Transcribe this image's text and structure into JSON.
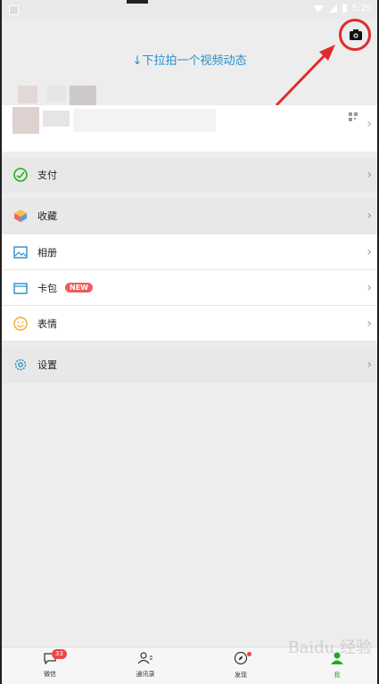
{
  "status": {
    "time": "5:29"
  },
  "header": {
    "pull_hint": "↓下拉拍一个视频动态"
  },
  "menu": [
    {
      "label": "支付",
      "icon": "pay-icon"
    },
    {
      "label": "收藏",
      "icon": "favorites-icon"
    },
    {
      "label": "相册",
      "icon": "album-icon"
    },
    {
      "label": "卡包",
      "icon": "card-icon",
      "badge": "NEW"
    },
    {
      "label": "表情",
      "icon": "emoji-icon"
    },
    {
      "label": "设置",
      "icon": "settings-icon"
    }
  ],
  "tabbar": [
    {
      "label": "微信",
      "icon": "chat-icon",
      "badge": "33"
    },
    {
      "label": "通讯录",
      "icon": "contacts-icon"
    },
    {
      "label": "发现",
      "icon": "discover-icon",
      "dot": true
    },
    {
      "label": "我",
      "icon": "me-icon",
      "active": true
    }
  ],
  "colors": {
    "accent": "#1aad19",
    "link": "#2a8ec9",
    "annotation": "#e02b2b"
  },
  "watermark": "Baidu 经验"
}
